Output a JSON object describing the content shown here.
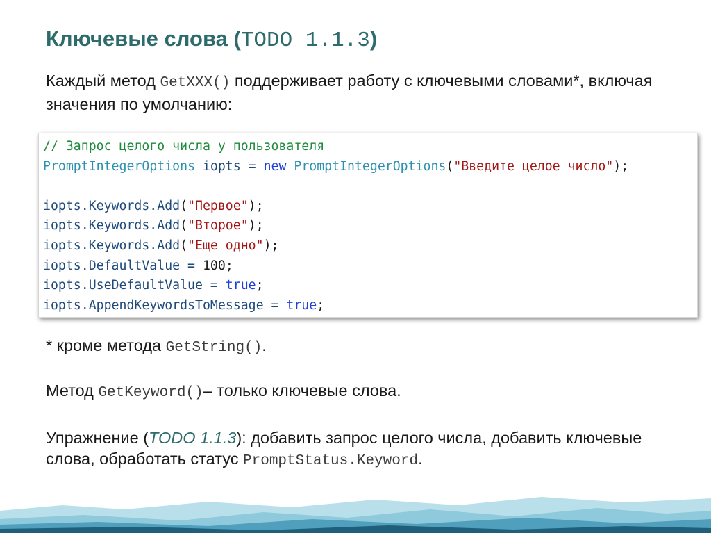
{
  "title": {
    "text": "Ключевые слова (",
    "code": "TODO 1.1.3",
    "close": ")"
  },
  "intro": {
    "part1": "Каждый метод ",
    "code": "GetXXX()",
    "part2": " поддерживает работу с ключевыми словами*, включая значения по умолчанию:"
  },
  "code_block": {
    "line1": "// Запрос целого числа у пользователя",
    "line2": {
      "type": "PromptIntegerOptions",
      "var": " iopts = ",
      "kw": "new",
      "type2": " PromptIntegerOptions",
      "open": "(",
      "str": "\"Введите целое число\"",
      "close": ");"
    },
    "keyword_lines": [
      {
        "prefix": "iopts.Keywords.",
        "method": "Add",
        "open": "(",
        "str": "\"Первое\"",
        "close": ");"
      },
      {
        "prefix": "iopts.Keywords.",
        "method": "Add",
        "open": "(",
        "str": "\"Второе\"",
        "close": ");"
      },
      {
        "prefix": "iopts.Keywords.",
        "method": "Add",
        "open": "(",
        "str": "\"Еще одно\"",
        "close": ");"
      }
    ],
    "line_default": {
      "prefix": "iopts.DefaultValue = ",
      "value": "100",
      "close": ";"
    },
    "line_use": {
      "prefix": "iopts.UseDefaultValue = ",
      "value": "true",
      "close": ";"
    },
    "line_append": {
      "prefix": "iopts.AppendKeywordsToMessage = ",
      "value": "true",
      "close": ";"
    }
  },
  "footnote": {
    "part1": "* кроме метода ",
    "code": "GetString()",
    "part2": "."
  },
  "method_note": {
    "part1": "Метод ",
    "code": "GetKeyword()",
    "part2": "– только ключевые слова."
  },
  "exercise": {
    "part1": "Упражнение (",
    "todo": "TODO 1.1.3",
    "part2": "): добавить запрос целого числа, добавить ключевые слова, обработать статус ",
    "code": "PromptStatus.Keyword",
    "part3": "."
  },
  "colors": {
    "title": "#2e6b6c",
    "footer_dark": "#1f5f7a",
    "footer_light": "#8ec9dc"
  }
}
